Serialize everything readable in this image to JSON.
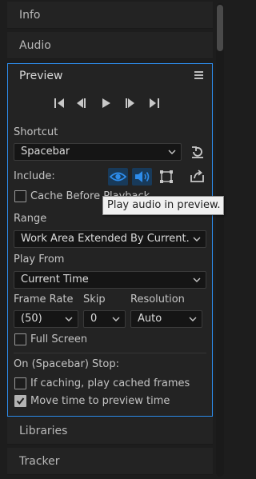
{
  "tabs": {
    "info": "Info",
    "audio": "Audio",
    "libraries": "Libraries",
    "tracker": "Tracker"
  },
  "preview": {
    "title": "Preview",
    "shortcut_label": "Shortcut",
    "shortcut_value": "Spacebar",
    "include_label": "Include:",
    "cache_before_playback": {
      "label": "Cache Before Playback",
      "checked": false
    },
    "range_label": "Range",
    "range_value": "Work Area Extended By Current…",
    "play_from_label": "Play From",
    "play_from_value": "Current Time",
    "frame_rate_label": "Frame Rate",
    "frame_rate_value": "(50)",
    "skip_label": "Skip",
    "skip_value": "0",
    "resolution_label": "Resolution",
    "resolution_value": "Auto",
    "full_screen": {
      "label": "Full Screen",
      "checked": false
    },
    "on_stop_label": "On (Spacebar) Stop:",
    "if_caching": {
      "label": "If caching, play cached frames",
      "checked": false
    },
    "move_time": {
      "label": "Move time to preview time",
      "checked": true
    }
  },
  "tooltip": "Play audio in preview.",
  "colors": {
    "accent": "#2d8ceb",
    "panel": "#232323",
    "background": "#1d1d1d"
  },
  "icons": [
    "first-frame-icon",
    "previous-frame-icon",
    "play-icon",
    "next-frame-icon",
    "last-frame-icon",
    "chevron-down-icon",
    "reset-icon",
    "eye-icon",
    "speaker-icon",
    "overlay-icon",
    "export-icon",
    "hamburger-menu-icon"
  ]
}
